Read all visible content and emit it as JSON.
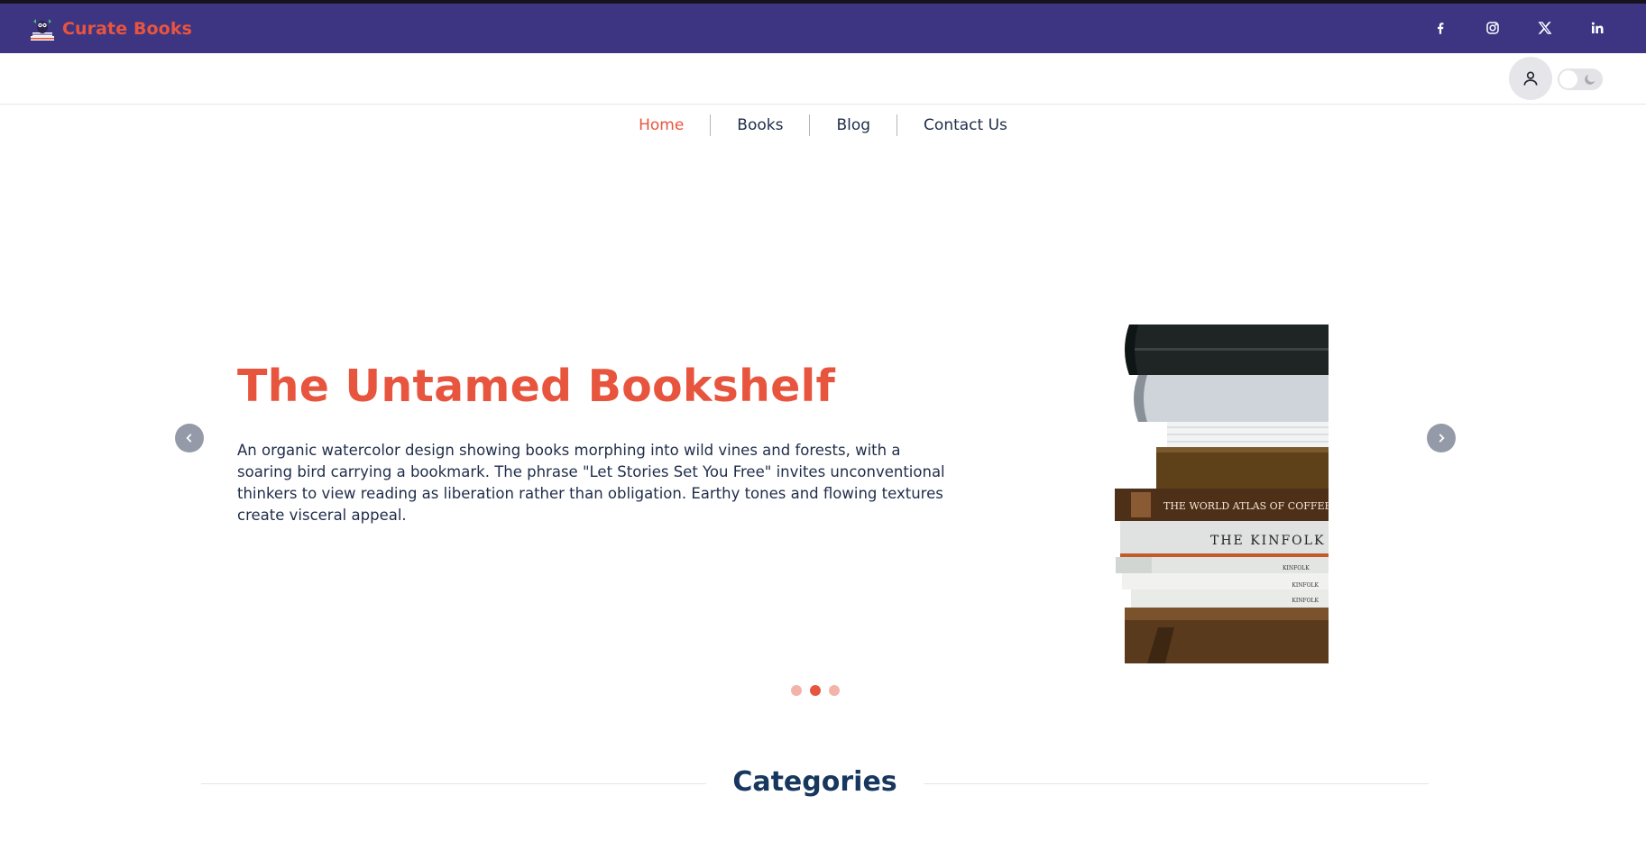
{
  "brand": {
    "name": "Curate Books",
    "logo_icon": "bookworm-logo-icon"
  },
  "header": {
    "socials": [
      {
        "name": "facebook-icon",
        "label": "Facebook"
      },
      {
        "name": "instagram-icon",
        "label": "Instagram"
      },
      {
        "name": "x-twitter-icon",
        "label": "X"
      },
      {
        "name": "linkedin-icon",
        "label": "LinkedIn"
      }
    ],
    "user_icon": "user-icon",
    "theme_toggle": {
      "state": "light",
      "icon": "moon-icon"
    }
  },
  "nav": {
    "items": [
      {
        "label": "Home",
        "active": true
      },
      {
        "label": "Books",
        "active": false
      },
      {
        "label": "Blog",
        "active": false
      },
      {
        "label": "Contact Us",
        "active": false
      }
    ]
  },
  "hero": {
    "title": "The Untamed Bookshelf",
    "description": "An organic watercolor design showing books morphing into wild vines and forests, with a soaring bird carrying a bookmark. The phrase \"Let Stories Set You Free\" invites unconventional thinkers to view reading as liberation rather than obligation. Earthy tones and flowing textures create visceral appeal.",
    "image_spines": [
      "THE WORLD ATLAS OF COFFEE",
      "THE KINFOLK",
      "KINFOLK",
      "KINFOLK",
      "KINFOLK"
    ],
    "prev_icon": "chevron-left-icon",
    "next_icon": "chevron-right-icon",
    "slides_total": 3,
    "slide_active": 2
  },
  "categories": {
    "title": "Categories"
  },
  "colors": {
    "topbar": "#3d3482",
    "accent": "#e8553e",
    "heading_dark": "#17375e",
    "text": "#1f2d4a"
  }
}
